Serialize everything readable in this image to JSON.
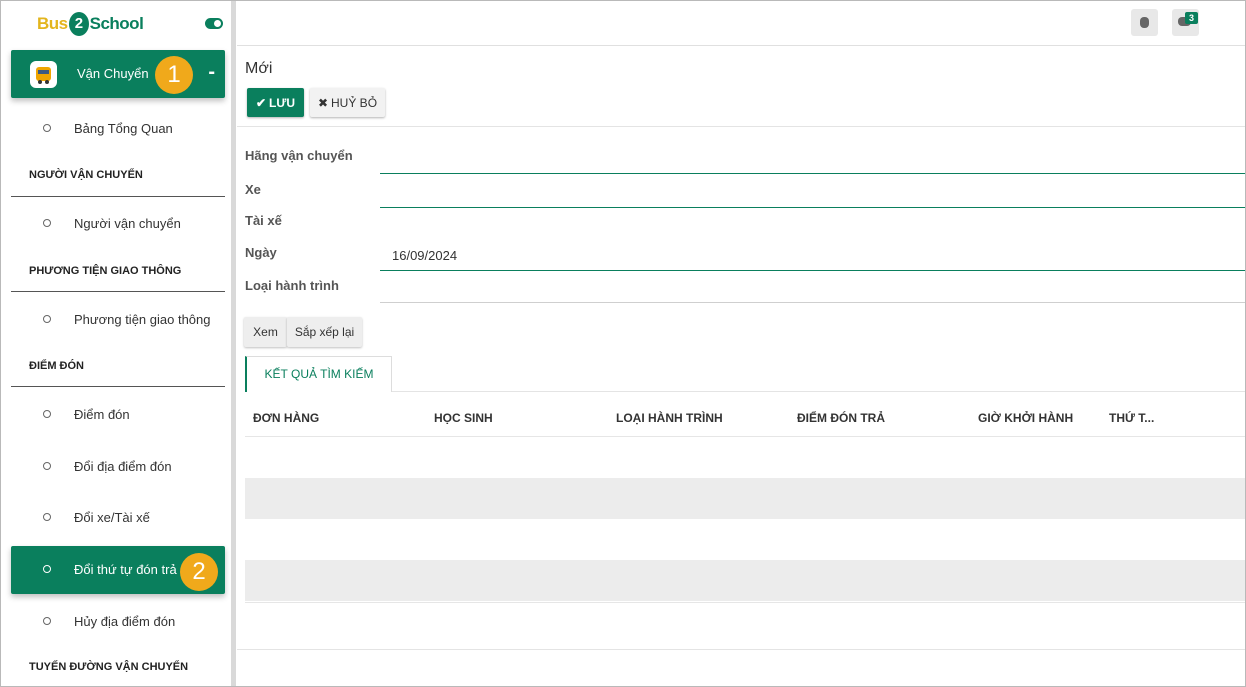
{
  "logo": {
    "part1": "Bus",
    "part2": "2",
    "part3": "School"
  },
  "sidebar": {
    "module_label": "Vận Chuyển",
    "module_toggle": "-",
    "items": {
      "overview": "Bảng Tổng Quan",
      "carrier": "Người vận chuyển",
      "vehicle": "Phương tiện giao thông",
      "pickup": "Điểm đón",
      "change_pickup": "Đổi địa điểm đón",
      "change_vehicle": "Đổi xe/Tài xế",
      "change_order": "Đổi thứ tự đón trả",
      "cancel_pickup": "Hủy địa điểm đón"
    },
    "sections": {
      "carrier": "NGƯỜI VẬN CHUYỂN",
      "vehicle": "PHƯƠNG TIỆN GIAO THÔNG",
      "pickup": "ĐIỂM ĐÓN",
      "route": "TUYẾN ĐƯỜNG VẬN CHUYỂN"
    }
  },
  "badges": {
    "first": "1",
    "second": "2"
  },
  "topbar": {
    "chat_count": "3"
  },
  "form": {
    "title": "Mới",
    "save_label": "LƯU",
    "cancel_label": "HUỶ BỎ",
    "labels": {
      "carrier_company": "Hãng vận chuyển",
      "vehicle": "Xe",
      "driver": "Tài xế",
      "date": "Ngày",
      "route_type": "Loại hành trình"
    },
    "date_value": "16/09/2024",
    "view_label": "Xem",
    "reorder_label": "Sắp xếp lại"
  },
  "results": {
    "tab_label": "KẾT QUẢ TÌM KIẾM",
    "columns": [
      "ĐƠN HÀNG",
      "HỌC SINH",
      "LOẠI HÀNH TRÌNH",
      "ĐIỂM ĐÓN TRẢ",
      "GIỜ KHỞI HÀNH",
      "THỨ T..."
    ]
  },
  "colors": {
    "primary": "#0a7f5d",
    "badge": "#f0a91b",
    "logo_yellow": "#e3b51d"
  }
}
